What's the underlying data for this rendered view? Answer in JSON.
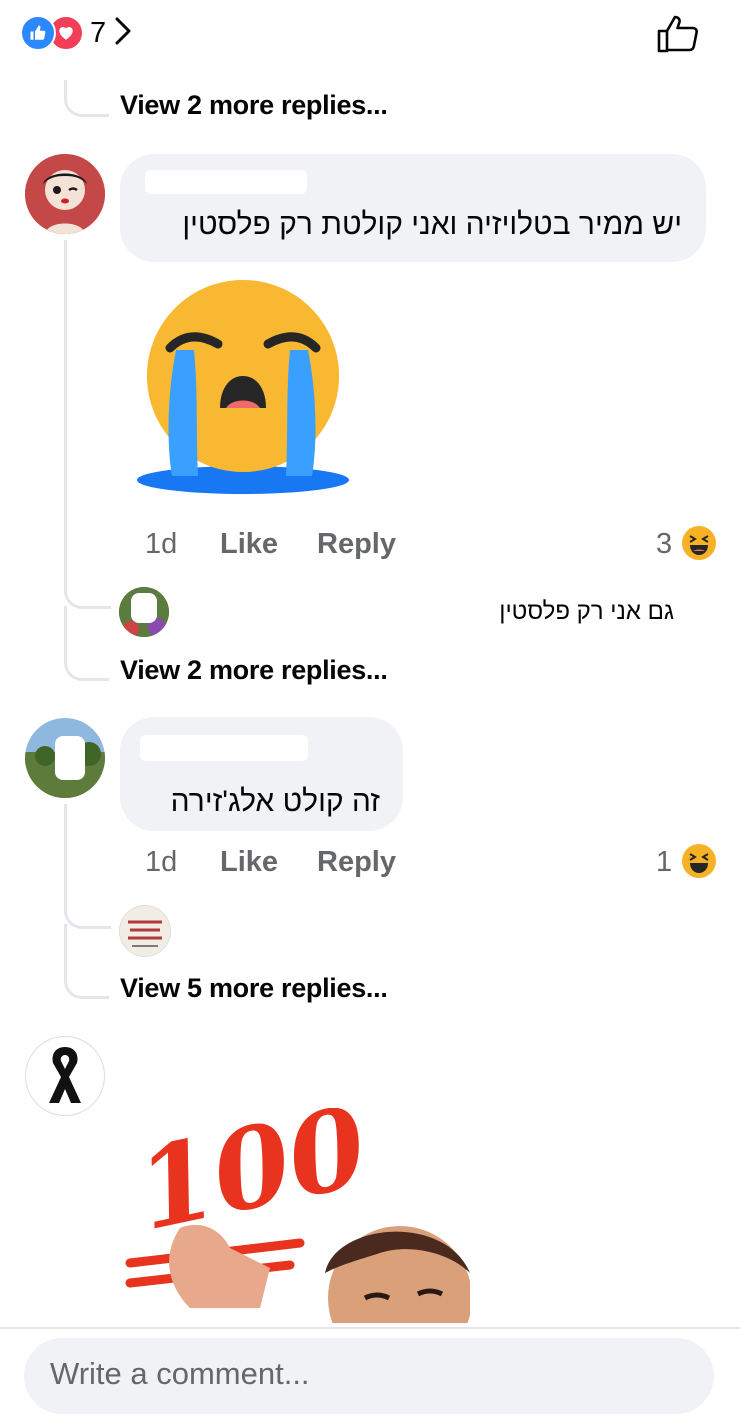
{
  "reactions": {
    "count": "7"
  },
  "thread1": {
    "more_replies": "View 2 more replies..."
  },
  "comment1": {
    "text": "יש ממיר בטלויזיה ואני קולטת רק פלסטין",
    "time": "1d",
    "like": "Like",
    "reply": "Reply",
    "reaction_count": "3",
    "sub_reply_text": "גם אני רק פלסטין",
    "more_replies": "View 2 more replies..."
  },
  "comment2": {
    "text": "זה קולט אלג'זירה",
    "time": "1d",
    "like": "Like",
    "reply": "Reply",
    "reaction_count": "1",
    "more_replies": "View 5 more replies..."
  },
  "comment3": {
    "sticker_text": "100"
  },
  "composer": {
    "placeholder": "Write a comment..."
  },
  "colors": {
    "like_blue": "#2d88ff",
    "love_red": "#f33e58",
    "haha_yellow": "#f7b125",
    "bubble_gray": "#f0f2f5"
  },
  "icons": [
    "like-reaction-icon",
    "love-reaction-icon",
    "chevron-right-icon",
    "thumbs-up-icon",
    "haha-reaction-icon",
    "black-ribbon-icon",
    "crying-emoji"
  ]
}
